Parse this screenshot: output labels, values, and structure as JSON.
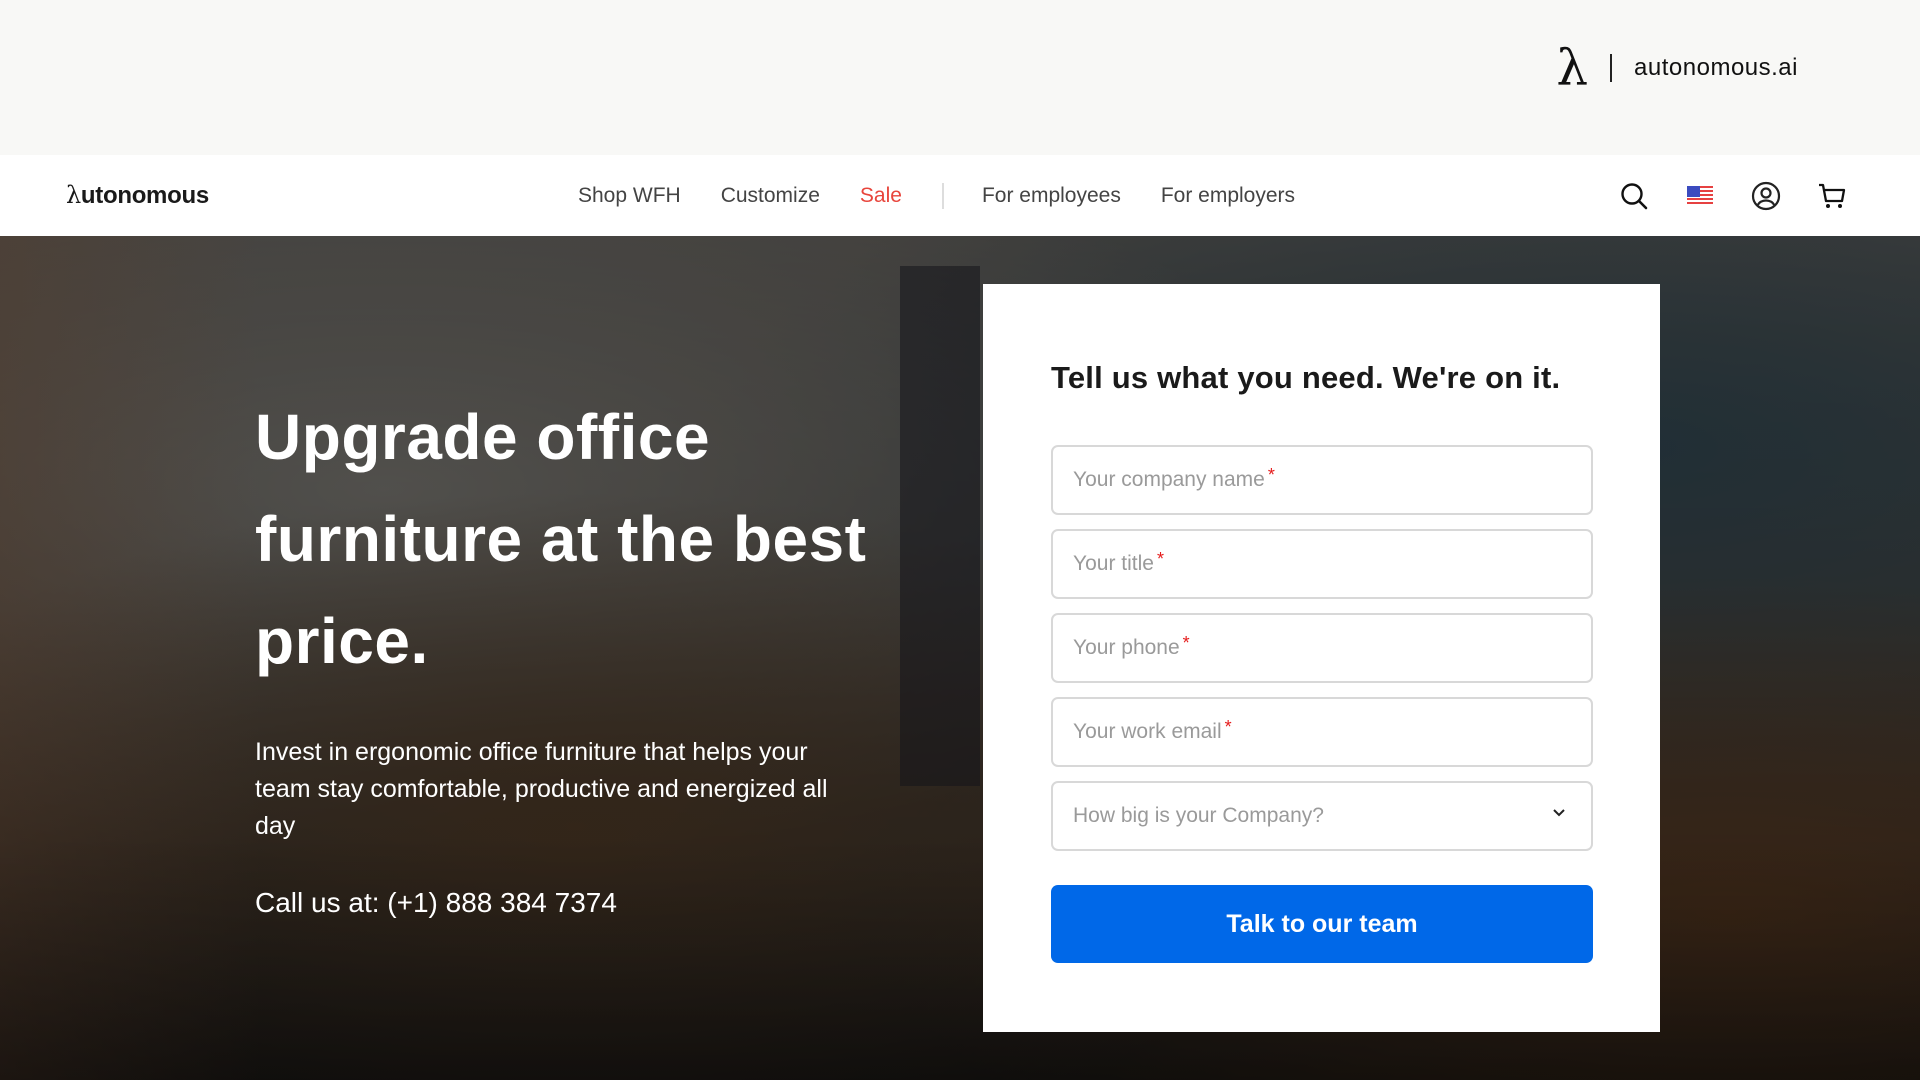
{
  "banner": {
    "brand_name": "autonomous.ai",
    "lambda_glyph": "λ"
  },
  "nav": {
    "logo_lambda": "λ",
    "logo_text": "utonomous",
    "items": [
      {
        "label": "Shop WFH"
      },
      {
        "label": "Customize"
      },
      {
        "label": "Sale",
        "color": "#e8453c"
      },
      {
        "label": "For employees"
      },
      {
        "label": "For employers"
      }
    ],
    "icons": [
      "search-icon",
      "us-flag-icon",
      "account-icon",
      "cart-icon"
    ]
  },
  "hero": {
    "title": "Upgrade office furniture at the best price.",
    "subtitle": "Invest in ergonomic office furniture that helps your team stay comfortable, productive and energized all day",
    "call": "Call us at: (+1) 888 384 7374"
  },
  "form": {
    "heading": "Tell us what you need. We're on it.",
    "fields": [
      {
        "placeholder": "Your company name",
        "required": "*"
      },
      {
        "placeholder": "Your title",
        "required": "*"
      },
      {
        "placeholder": "Your phone",
        "required": "*"
      },
      {
        "placeholder": "Your work email",
        "required": "*"
      }
    ],
    "select": {
      "placeholder": "How big is your Company?"
    },
    "submit_label": "Talk to our team",
    "accent_color": "#0068e8"
  }
}
